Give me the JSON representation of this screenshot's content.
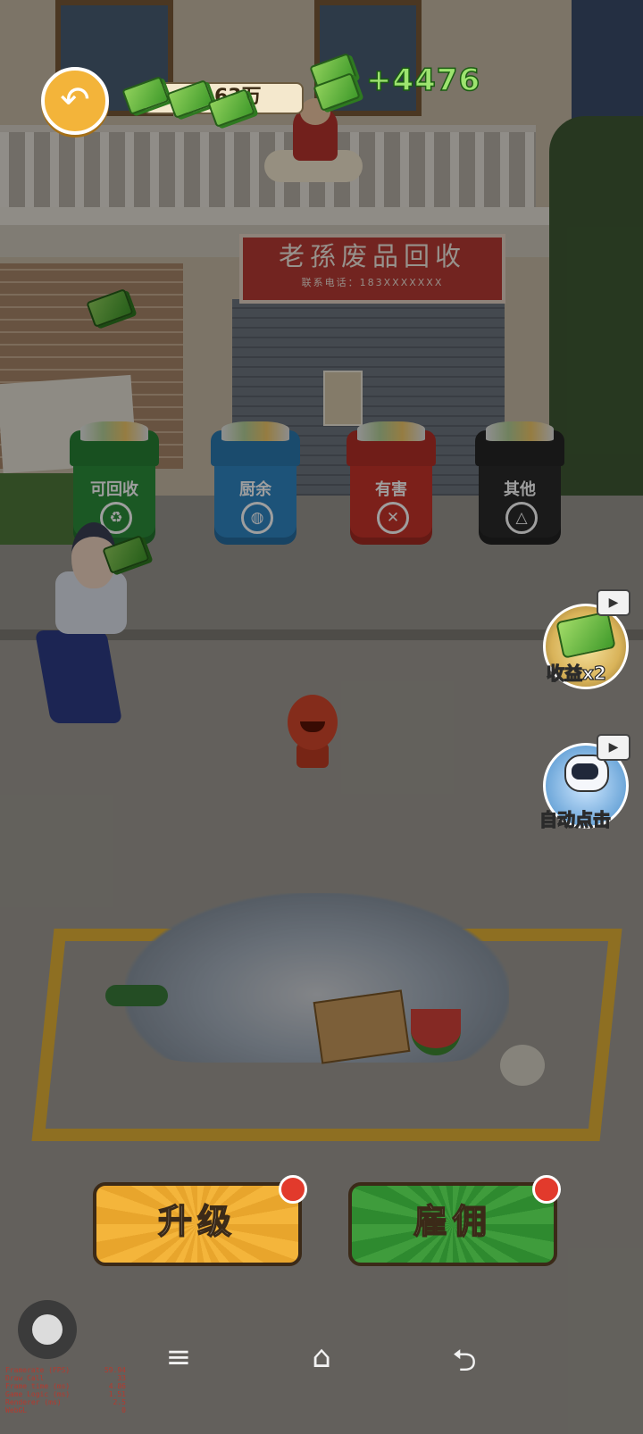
{
  "hud": {
    "back_icon": "back-arrow-icon",
    "coin_value": "63万",
    "gain_text": "+4476"
  },
  "shop": {
    "sign_title": "老孫废品回收",
    "sign_phone": "联系电话：183XXXXXXX"
  },
  "bins": [
    {
      "label": "可回收",
      "color": "#2d8f3a",
      "emblem": "♻",
      "icon": "recycle-icon"
    },
    {
      "label": "厨余",
      "color": "#2f86c4",
      "emblem": "◍",
      "icon": "food-waste-icon"
    },
    {
      "label": "有害",
      "color": "#c9342b",
      "emblem": "✕",
      "icon": "hazard-icon"
    },
    {
      "label": "其他",
      "color": "#2a2a2a",
      "emblem": "△",
      "icon": "other-waste-icon"
    }
  ],
  "side_buttons": {
    "income_label": "收益x2",
    "auto_label": "自动点击",
    "video_icon": "video-ad-icon"
  },
  "actions": {
    "upgrade_label": "升级",
    "hire_label": "雇佣"
  },
  "debug": [
    {
      "k": "Framerate (FPS)",
      "v": "59.94"
    },
    {
      "k": "Draw Call",
      "v": "33"
    },
    {
      "k": "Frame time (ms)",
      "v": "4.86"
    },
    {
      "k": "Game Logic (ms)",
      "v": "1.51"
    },
    {
      "k": "Renderer (ms)",
      "v": "2.5"
    },
    {
      "k": "WebGL",
      "v": "0"
    }
  ],
  "nav": {
    "menu": "≡",
    "home": "⌂",
    "back": "⮌"
  },
  "colors": {
    "upgrade": "#f4b53b",
    "hire": "#3f9c3c",
    "zone": "#e5b437",
    "sign": "#b83a34"
  }
}
